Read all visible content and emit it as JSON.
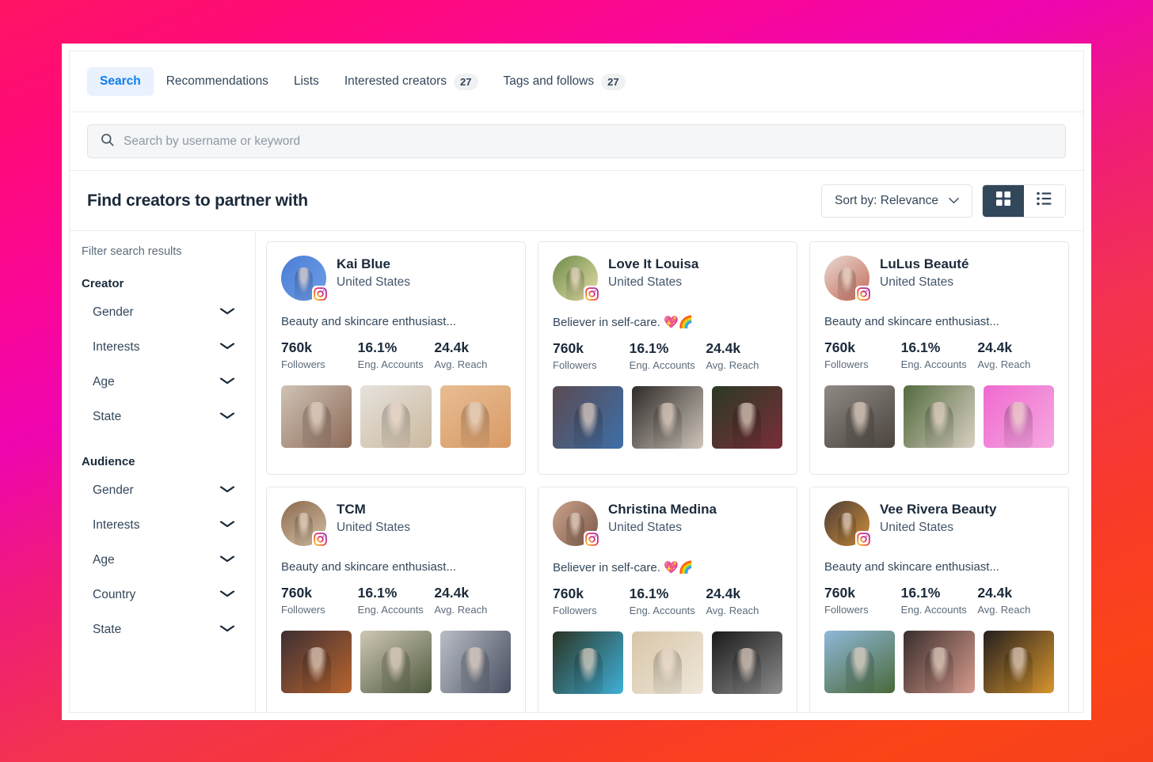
{
  "tabs": [
    {
      "label": "Search",
      "count": null,
      "active": true
    },
    {
      "label": "Recommendations",
      "count": null,
      "active": false
    },
    {
      "label": "Lists",
      "count": null,
      "active": false
    },
    {
      "label": "Interested creators",
      "count": "27",
      "active": false
    },
    {
      "label": "Tags and follows",
      "count": "27",
      "active": false
    }
  ],
  "search": {
    "placeholder": "Search by username or keyword",
    "icon": "search-icon"
  },
  "header": {
    "title": "Find creators to partner with",
    "sort_label": "Sort by: Relevance",
    "sort_caret": "caret-down-icon",
    "view_grid": "grid-view-icon",
    "view_list": "list-view-icon",
    "active_view": "grid"
  },
  "sidebar": {
    "heading": "Filter search results",
    "groups": [
      {
        "title": "Creator",
        "items": [
          {
            "label": "Gender"
          },
          {
            "label": "Interests"
          },
          {
            "label": "Age"
          },
          {
            "label": "State"
          }
        ]
      },
      {
        "title": "Audience",
        "items": [
          {
            "label": "Gender"
          },
          {
            "label": "Interests"
          },
          {
            "label": "Age"
          },
          {
            "label": "Country"
          },
          {
            "label": "State"
          }
        ]
      }
    ],
    "chevron": "chevron-down-icon"
  },
  "stat_labels": {
    "followers": "Followers",
    "engagement": "Eng. Accounts",
    "reach": "Avg. Reach"
  },
  "creators": [
    {
      "name": "Kai Blue",
      "location": "United States",
      "bio": "Beauty and skincare enthusiast...",
      "platform": "instagram",
      "followers": "760k",
      "engagement": "16.1%",
      "reach": "24.4k",
      "avatar_colors": [
        "#4a7ed6",
        "#6f9ee6"
      ],
      "thumb_colors": [
        [
          "#cfc3b6",
          "#8d6a57"
        ],
        [
          "#e6e2dc",
          "#cbb99f"
        ],
        [
          "#e8bd92",
          "#d89a66"
        ]
      ]
    },
    {
      "name": "Love It Louisa",
      "location": "United States",
      "bio": "Believer in self-care. 💖🌈",
      "platform": "instagram",
      "followers": "760k",
      "engagement": "16.1%",
      "reach": "24.4k",
      "avatar_colors": [
        "#6c8a4a",
        "#e8e0a8"
      ],
      "thumb_colors": [
        [
          "#5b4a52",
          "#3d6fa8"
        ],
        [
          "#2e2a28",
          "#cfc6bb"
        ],
        [
          "#2b3a24",
          "#7a2e3a"
        ]
      ]
    },
    {
      "name": "LuLus Beauté",
      "location": "United States",
      "bio": "Beauty and skincare enthusiast...",
      "platform": "instagram",
      "followers": "760k",
      "engagement": "16.1%",
      "reach": "24.4k",
      "avatar_colors": [
        "#e8d9d0",
        "#c46a5a"
      ],
      "thumb_colors": [
        [
          "#8f8a84",
          "#4a433e"
        ],
        [
          "#536b3e",
          "#d8cfc2"
        ],
        [
          "#f06ad0",
          "#f5a8e0"
        ]
      ]
    },
    {
      "name": "TCM",
      "location": "United States",
      "bio": "Beauty and skincare enthusiast...",
      "platform": "instagram",
      "followers": "760k",
      "engagement": "16.1%",
      "reach": "24.4k",
      "avatar_colors": [
        "#8a6a4e",
        "#d6c0a6"
      ],
      "thumb_colors": [
        [
          "#3e2f33",
          "#b8642e"
        ],
        [
          "#cfc7b4",
          "#4e5a3e"
        ],
        [
          "#b9bec6",
          "#4a5062"
        ]
      ]
    },
    {
      "name": "Christina Medina",
      "location": "United States",
      "bio": "Believer in self-care. 💖🌈",
      "platform": "instagram",
      "followers": "760k",
      "engagement": "16.1%",
      "reach": "24.4k",
      "avatar_colors": [
        "#caa28c",
        "#7d5a4a"
      ],
      "thumb_colors": [
        [
          "#2b3322",
          "#3fb0d8"
        ],
        [
          "#d8c6a8",
          "#efe7da"
        ],
        [
          "#1a1a1a",
          "#8d8d8d"
        ]
      ]
    },
    {
      "name": "Vee Rivera Beauty",
      "location": "United States",
      "bio": "Beauty and skincare enthusiast...",
      "platform": "instagram",
      "followers": "760k",
      "engagement": "16.1%",
      "reach": "24.4k",
      "avatar_colors": [
        "#4a3c36",
        "#d08f3a"
      ],
      "thumb_colors": [
        [
          "#8fb8d8",
          "#4a6a3a"
        ],
        [
          "#3a2e2c",
          "#d4998c"
        ],
        [
          "#241f1e",
          "#d8952e"
        ]
      ]
    }
  ],
  "colors": {
    "accent_blue": "#0d7ee9",
    "dark_navy": "#33475b",
    "bg_gradient_start": "#ff1464",
    "bg_gradient_mid": "#ef05b0",
    "bg_gradient_end": "#f5401b"
  }
}
